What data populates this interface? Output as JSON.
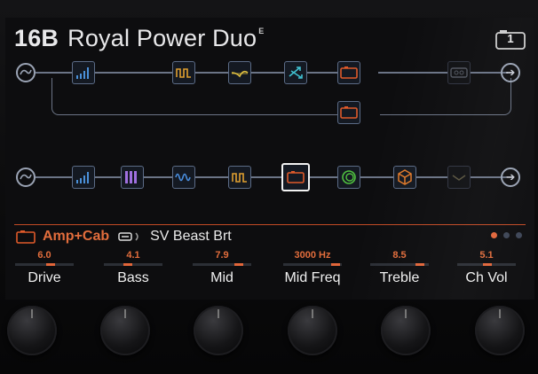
{
  "preset": {
    "number": "16B",
    "name": "Royal Power Duo",
    "edited_marker": "E"
  },
  "snapshot": {
    "number": "1",
    "icon": "camera-icon"
  },
  "path_a": {
    "input_icon": "input-icon",
    "output_icon": "arrow-right-icon",
    "blocks": [
      {
        "type": "volume",
        "color": "#4a90d9"
      },
      {
        "type": "filter",
        "color": "#e0a030"
      },
      {
        "type": "eq",
        "color": "#e0c040"
      },
      {
        "type": "split",
        "color": "#40c0d0"
      },
      {
        "type": "amp",
        "color": "#e05a2a"
      },
      {
        "type": "looper",
        "color": "#50555e"
      },
      {
        "type": "amp",
        "color": "#e05a2a"
      }
    ]
  },
  "path_b": {
    "input_icon": "input-icon",
    "output_icon": "arrow-right-icon",
    "blocks": [
      {
        "type": "volume",
        "color": "#4a90d9"
      },
      {
        "type": "synth",
        "color": "#a070e0"
      },
      {
        "type": "modulation",
        "color": "#4a8fe0"
      },
      {
        "type": "filter",
        "color": "#e0a030"
      },
      {
        "type": "amp",
        "color": "#e05a2a",
        "selected": true
      },
      {
        "type": "reverb",
        "color": "#50c040"
      },
      {
        "type": "cab",
        "color": "#e07a2a"
      },
      {
        "type": "empty",
        "color": "#50555e"
      }
    ]
  },
  "selected_block": {
    "category": "Amp+Cab",
    "model": "SV Beast Brt",
    "page_dots": 3,
    "active_dot": 0,
    "accent": "#e2663a"
  },
  "params": [
    {
      "name": "Drive",
      "value": "6.0",
      "level": 0.6
    },
    {
      "name": "Bass",
      "value": "4.1",
      "level": 0.41
    },
    {
      "name": "Mid",
      "value": "7.9",
      "level": 0.79
    },
    {
      "name": "Mid Freq",
      "value": "3000 Hz",
      "level": 0.9
    },
    {
      "name": "Treble",
      "value": "8.5",
      "level": 0.85
    },
    {
      "name": "Ch Vol",
      "value": "5.1",
      "level": 0.51
    }
  ]
}
